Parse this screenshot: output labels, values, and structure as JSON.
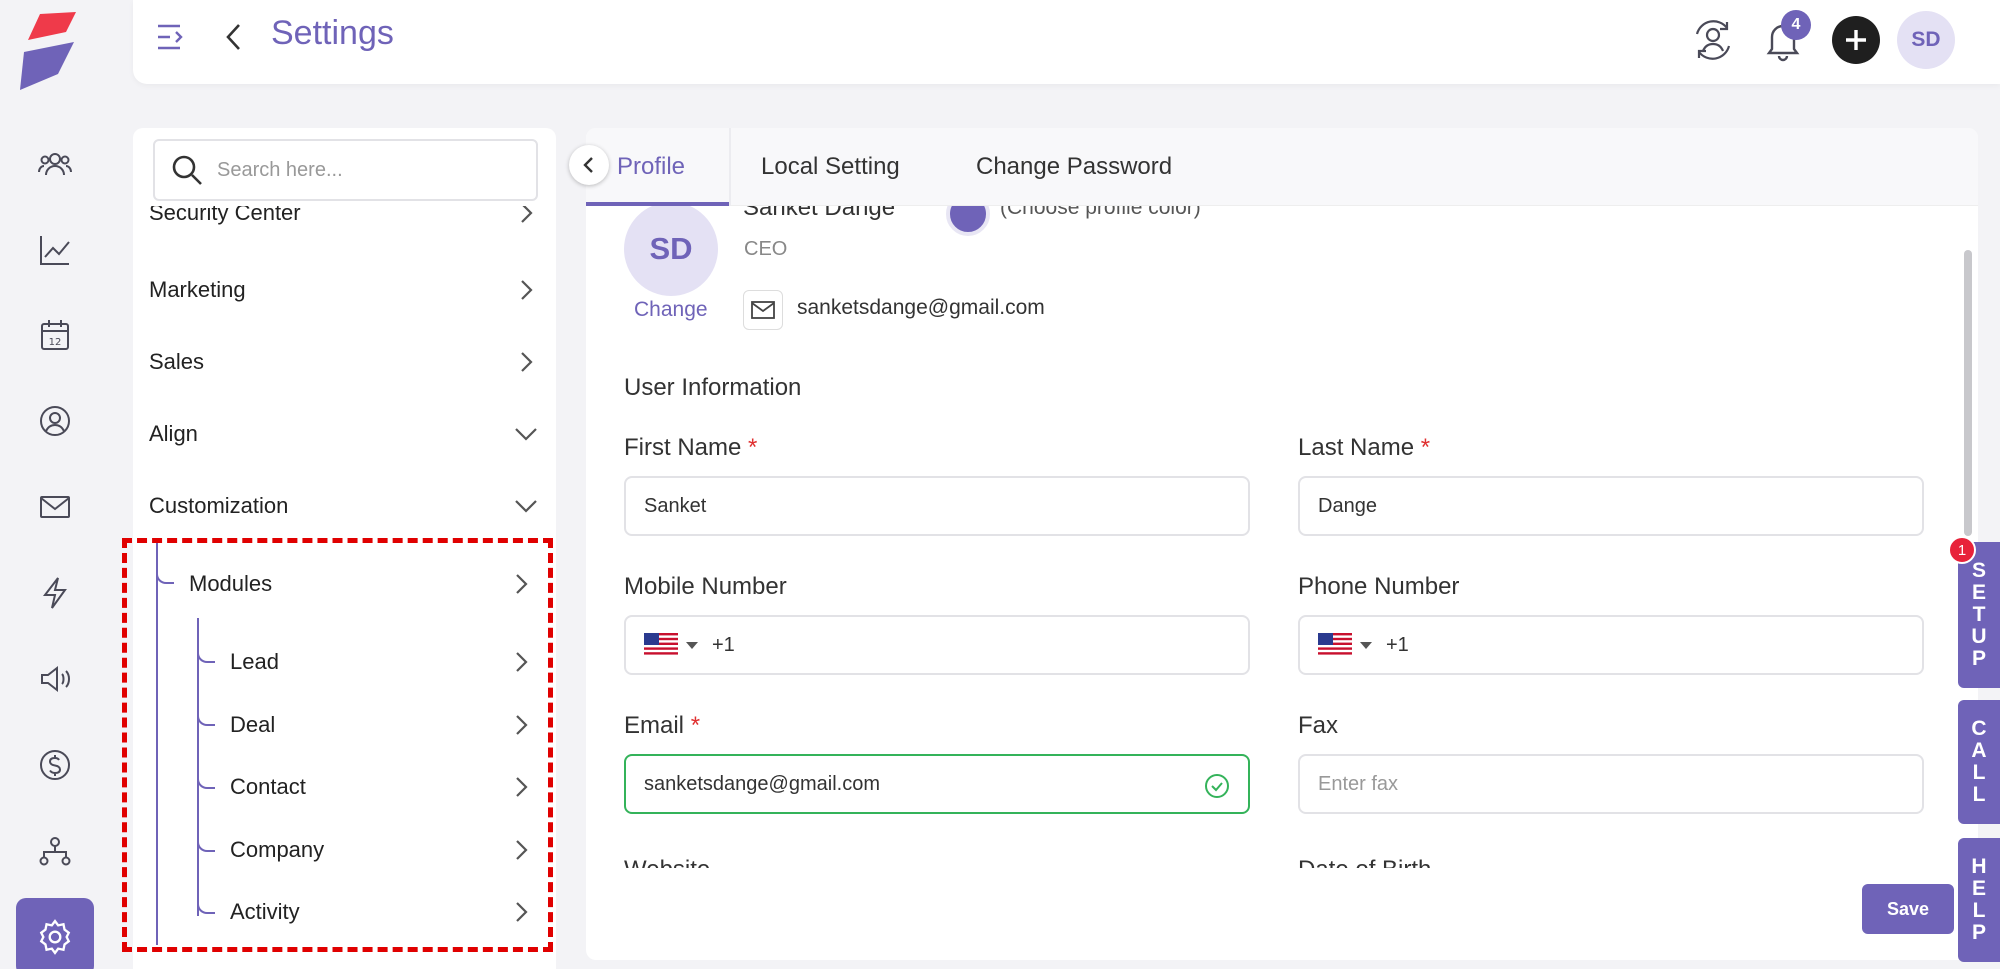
{
  "header": {
    "title": "Settings",
    "notification_count": "4",
    "avatar_initials": "SD"
  },
  "search": {
    "placeholder": "Search here..."
  },
  "settings_menu": {
    "partial_item": "Security Center",
    "items": [
      {
        "label": "Marketing",
        "state": "collapsed"
      },
      {
        "label": "Sales",
        "state": "collapsed"
      },
      {
        "label": "Align",
        "state": "expanded"
      },
      {
        "label": "Customization",
        "state": "expanded"
      }
    ],
    "modules": {
      "label": "Modules",
      "children": [
        "Lead",
        "Deal",
        "Contact",
        "Company",
        "Activity"
      ]
    }
  },
  "tabs": [
    "Profile",
    "Local Setting",
    "Change Password"
  ],
  "profile": {
    "initials": "SD",
    "change_label": "Change",
    "name": "Sanket Dange",
    "role": "CEO",
    "color_hint": "(Choose profile color)",
    "email": "sanketsdange@gmail.com",
    "accent_color": "#6f63b8"
  },
  "form": {
    "section_title": "User Information",
    "required_mark": "*",
    "first_name": {
      "label": "First Name",
      "value": "Sanket"
    },
    "last_name": {
      "label": "Last Name",
      "value": "Dange"
    },
    "mobile": {
      "label": "Mobile Number",
      "code": "+1"
    },
    "phone": {
      "label": "Phone Number",
      "code": "+1"
    },
    "email": {
      "label": "Email",
      "value": "sanketsdange@gmail.com"
    },
    "fax": {
      "label": "Fax",
      "placeholder": "Enter fax"
    },
    "website": {
      "label": "Website"
    },
    "dob": {
      "label": "Date of Birth"
    }
  },
  "actions": {
    "save_label": "Save"
  },
  "side_tabs": {
    "setup": [
      "S",
      "E",
      "T",
      "U",
      "P"
    ],
    "call": [
      "C",
      "A",
      "L",
      "L"
    ],
    "help": [
      "H",
      "E",
      "L",
      "P"
    ],
    "setup_badge": "1"
  }
}
